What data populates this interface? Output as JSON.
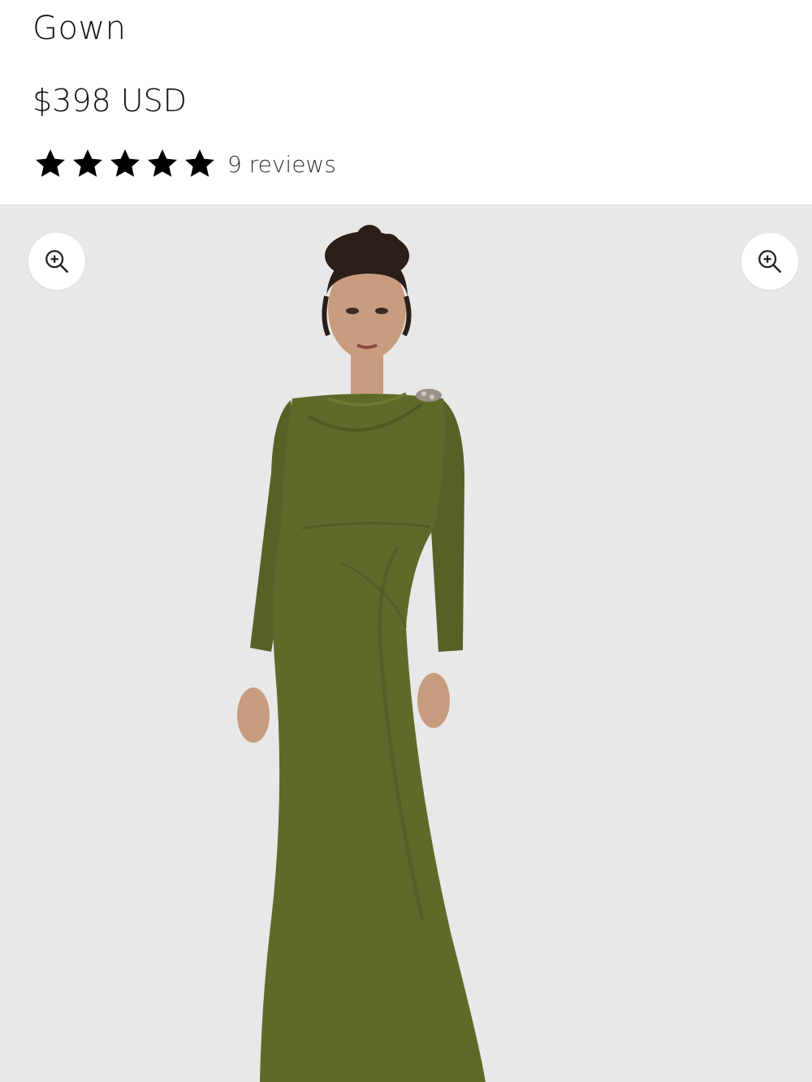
{
  "product": {
    "title": "Gown",
    "price": "$398 USD",
    "rating": {
      "stars": 5,
      "max_stars": 5,
      "reviews_label": "9 reviews"
    }
  },
  "gallery": {
    "zoom_icons": [
      "zoom-in-icon",
      "zoom-in-icon"
    ],
    "image_subject": "olive green long-sleeve gown",
    "colors": {
      "background": "#e8e8e8",
      "dress": "#5f6a2a",
      "skin": "#c89c7e",
      "hair": "#2a1e18"
    }
  },
  "icons": {
    "star": "star-icon",
    "zoom": "zoom-in-icon"
  }
}
